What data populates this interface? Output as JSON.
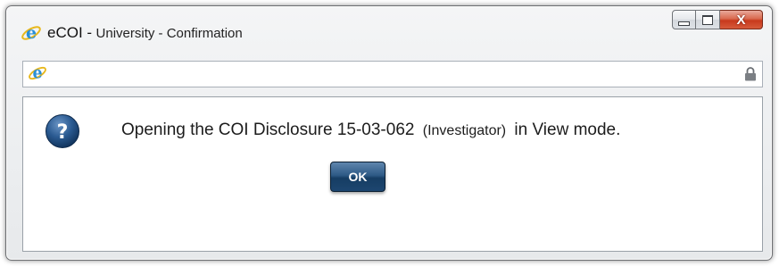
{
  "window": {
    "app_name": "eCOI -",
    "title": "University - Confirmation",
    "controls": {
      "minimize_icon": "minimize-icon",
      "maximize_icon": "maximize-icon",
      "close_icon": "close-icon",
      "close_label": "X"
    }
  },
  "address_bar": {
    "url": "",
    "page_icon": "ie-icon",
    "security_icon": "lock-icon"
  },
  "dialog": {
    "icon": "question-icon",
    "message_prefix": "Opening the COI Disclosure 15-03-062",
    "message_role": "(Investigator)",
    "message_suffix": "in View mode.",
    "ok_label": "OK"
  },
  "colors": {
    "close_button": "#c8391d",
    "ok_button": "#1d4670",
    "question_icon": "#1f4a7a",
    "ie_logo": "#2a8fd6"
  }
}
